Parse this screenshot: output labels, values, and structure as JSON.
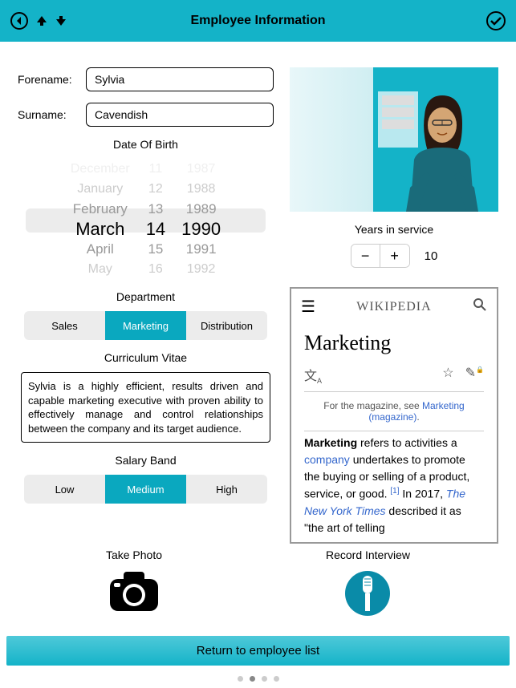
{
  "header": {
    "title": "Employee Information"
  },
  "fields": {
    "forename_label": "Forename:",
    "forename_value": "Sylvia",
    "surname_label": "Surname:",
    "surname_value": "Cavendish"
  },
  "dob": {
    "label": "Date Of Birth",
    "months": [
      "December",
      "January",
      "February",
      "March",
      "April",
      "May"
    ],
    "days": [
      "11",
      "12",
      "13",
      "14",
      "15",
      "16"
    ],
    "years": [
      "1987",
      "1988",
      "1989",
      "1990",
      "1991",
      "1992"
    ],
    "selected_index": 3
  },
  "department": {
    "label": "Department",
    "options": [
      "Sales",
      "Marketing",
      "Distribution"
    ],
    "selected": 1
  },
  "cv": {
    "label": "Curriculum Vitae",
    "text": "Sylvia is a highly efficient, results driven and capable marketing executive with proven ability to effectively manage and control relationships between the company and its target audience."
  },
  "salary": {
    "label": "Salary Band",
    "options": [
      "Low",
      "Medium",
      "High"
    ],
    "selected": 1
  },
  "service": {
    "label": "Years in service",
    "value": "10"
  },
  "wiki": {
    "logo": "WIKIPEDIA",
    "title": "Marketing",
    "note_prefix": "For the magazine, see ",
    "note_link": "Marketing (magazine)",
    "body_1": "Marketing",
    "body_2": " refers to activities a ",
    "body_3": "company",
    "body_4": " undertakes to promote the buying or selling of a product, service, or good. ",
    "body_ref": "[1]",
    "body_5": " In 2017, ",
    "body_6": "The New York Times",
    "body_7": " described it as \"the art of telling"
  },
  "actions": {
    "photo_label": "Take Photo",
    "interview_label": "Record Interview"
  },
  "footer": {
    "return": "Return to employee list"
  },
  "pager": {
    "count": 4,
    "active": 1
  }
}
